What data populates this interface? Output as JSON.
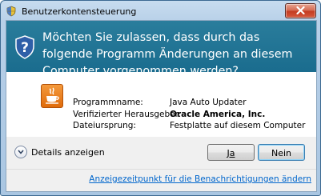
{
  "window": {
    "title": "Benutzerkontensteuerung",
    "title_icon": "uac-shield-icon",
    "close_icon": "close-icon"
  },
  "header": {
    "question": "Möchten Sie zulassen, dass durch das folgende Programm Änderungen an diesem Computer vorgenommen werden?",
    "icon": "uac-shield-question-icon",
    "background_color": "#1a6c8e"
  },
  "program_info": {
    "icon": "java-app-icon",
    "rows": [
      {
        "label": "Programmname:",
        "value": "Java Auto Updater"
      },
      {
        "label": "Verifizierter Herausgeber:",
        "value": "Oracle America, Inc."
      },
      {
        "label": "Dateiursprung:",
        "value": "Festplatte auf diesem Computer"
      }
    ]
  },
  "details": {
    "label": "Details anzeigen",
    "icon": "chevron-down-circle-icon"
  },
  "buttons": {
    "yes_label": "Ja",
    "no_label": "Nein"
  },
  "footer": {
    "link_text": "Anzeigezeitpunkt für die Benachrichtigungen ändern",
    "link_color": "#0066cc"
  }
}
